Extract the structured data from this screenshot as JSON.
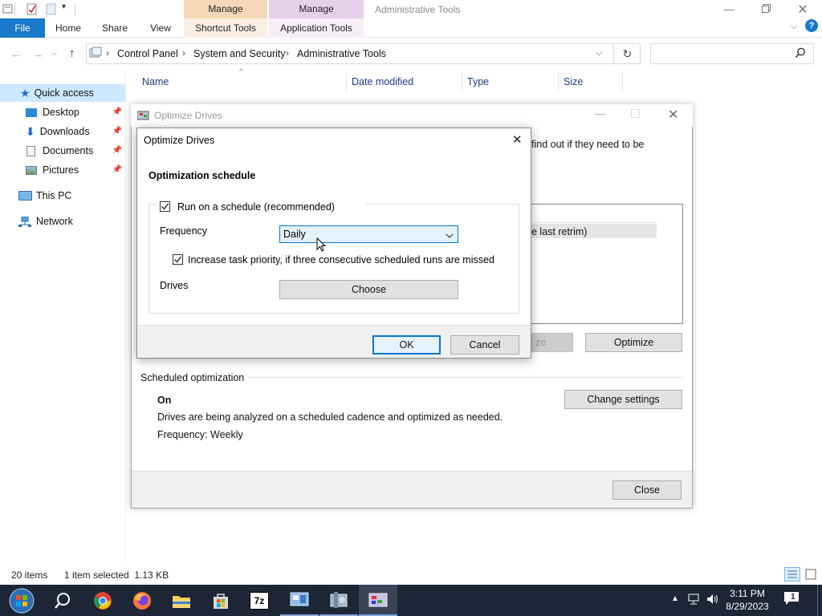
{
  "explorer": {
    "ribbon": {
      "context_group_1": "Manage",
      "context_group_2": "Manage",
      "window_title": "Administrative Tools",
      "tabs": {
        "file": "File",
        "home": "Home",
        "share": "Share",
        "view": "View",
        "shortcut_tools": "Shortcut Tools",
        "application_tools": "Application Tools"
      }
    },
    "address": {
      "crumbs": [
        "Control Panel",
        "System and Security",
        "Administrative Tools"
      ],
      "search_placeholder": ""
    },
    "nav": {
      "items": [
        {
          "label": "Quick access",
          "icon": "star-icon"
        },
        {
          "label": "Desktop",
          "icon": "desktop-folder-icon"
        },
        {
          "label": "Downloads",
          "icon": "download-arrow-icon"
        },
        {
          "label": "Documents",
          "icon": "document-icon"
        },
        {
          "label": "Pictures",
          "icon": "picture-icon"
        },
        {
          "label": "This PC",
          "icon": "computer-icon"
        },
        {
          "label": "Network",
          "icon": "network-icon"
        }
      ]
    },
    "columns": [
      "Name",
      "Date modified",
      "Type",
      "Size"
    ],
    "status": {
      "items_count": "20 items",
      "selected": "1 item selected  1.13 KB"
    }
  },
  "background_window": {
    "title": "Optimize Drives",
    "description_fragment": "find out if they need to be",
    "table_fragment": "e last retrim)",
    "analyze_fragment": "ze",
    "optimize_button": "Optimize",
    "scheduled_heading": "Scheduled optimization",
    "schedule_state": "On",
    "schedule_desc": "Drives are being analyzed on a scheduled cadence and optimized as needed.",
    "schedule_freq": "Frequency: Weekly",
    "change_settings_button": "Change settings",
    "close_button": "Close"
  },
  "dialog": {
    "title": "Optimize Drives",
    "section_heading": "Optimization schedule",
    "run_on_schedule_label": "Run on a schedule (recommended)",
    "run_on_schedule_checked": true,
    "frequency_label": "Frequency",
    "frequency_value": "Daily",
    "increase_priority_label": "Increase task priority, if three consecutive scheduled runs are missed",
    "increase_priority_checked": true,
    "drives_label": "Drives",
    "choose_button": "Choose",
    "ok_button": "OK",
    "cancel_button": "Cancel"
  },
  "taskbar": {
    "time": "3:11 PM",
    "date": "8/29/2023",
    "notification_count": "1"
  },
  "colors": {
    "accent": "#0078d7",
    "file_tab": "#1979ca",
    "taskbar": "#1d2636"
  }
}
